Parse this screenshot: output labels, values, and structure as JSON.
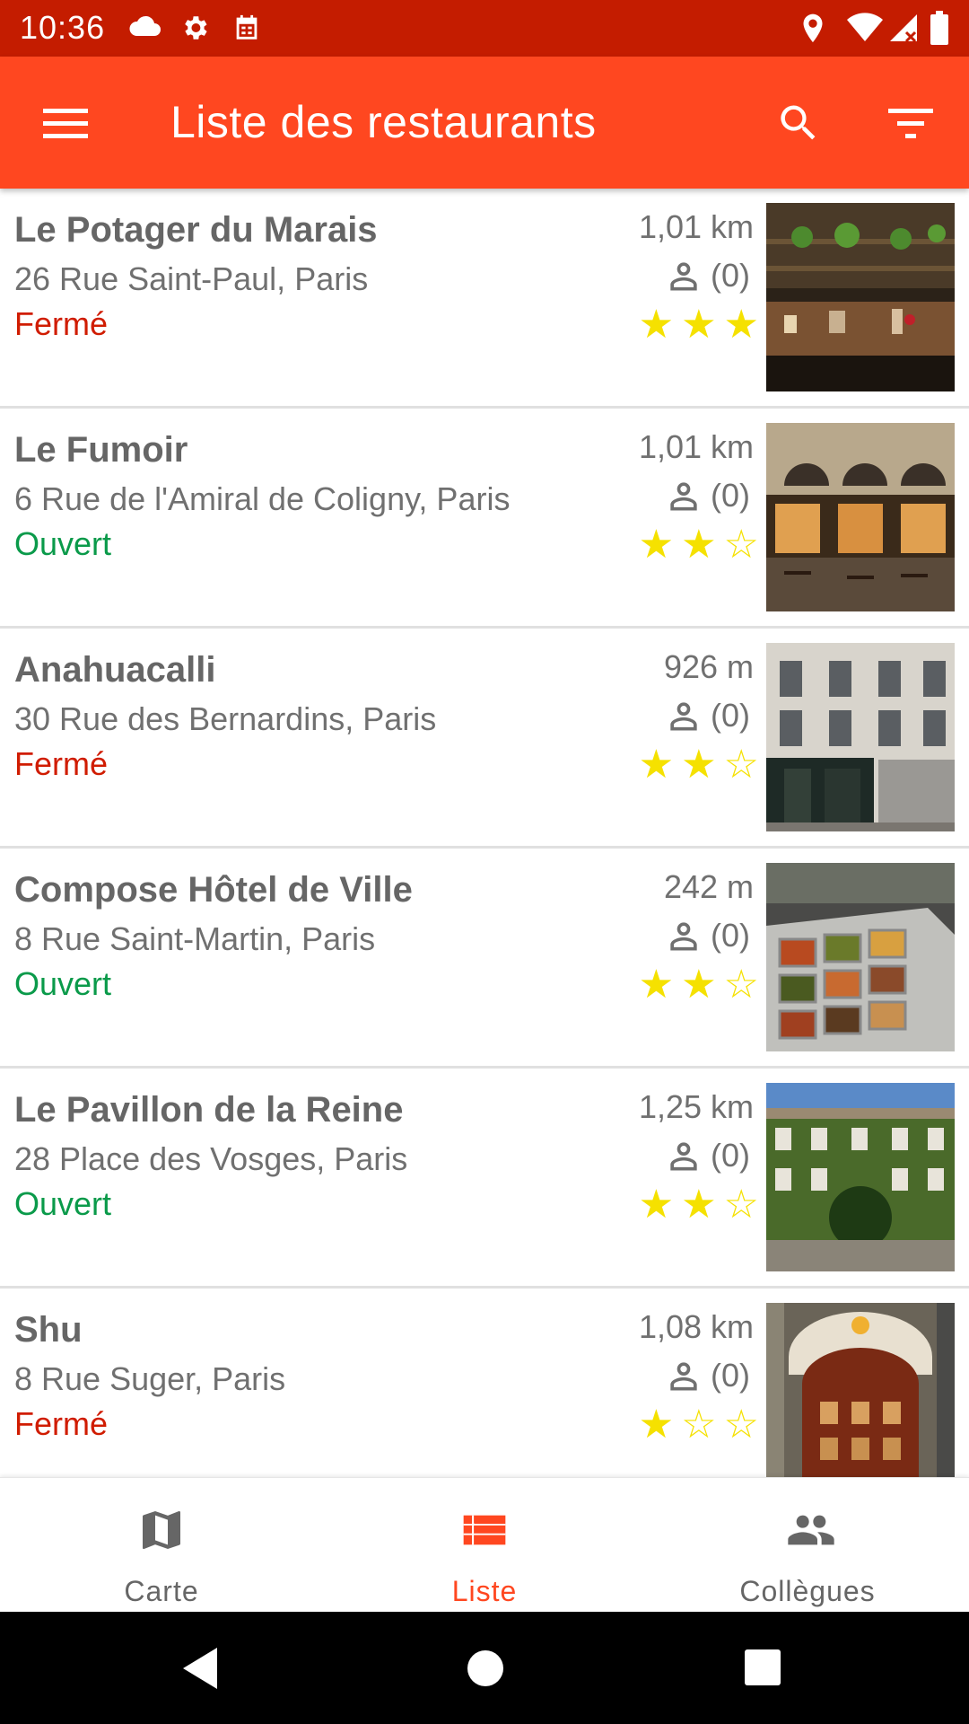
{
  "status_bar": {
    "time": "10:36"
  },
  "app_bar": {
    "title": "Liste des restaurants"
  },
  "colors": {
    "primary": "#ff4720",
    "status_bar": "#c41c00",
    "open": "#0a9a4a",
    "closed": "#d01c00",
    "star": "#f5e100"
  },
  "restaurants": [
    {
      "name": "Le Potager du Marais",
      "address": "26 Rue Saint-Paul, Paris",
      "status": "Fermé",
      "open": false,
      "distance": "1,01 km",
      "reviews": "(0)",
      "rating": 3
    },
    {
      "name": "Le Fumoir",
      "address": "6 Rue de l'Amiral de Coligny, Paris",
      "status": "Ouvert",
      "open": true,
      "distance": "1,01 km",
      "reviews": "(0)",
      "rating": 2
    },
    {
      "name": "Anahuacalli",
      "address": "30 Rue des Bernardins, Paris",
      "status": "Fermé",
      "open": false,
      "distance": "926 m",
      "reviews": "(0)",
      "rating": 2
    },
    {
      "name": "Compose Hôtel de Ville",
      "address": "8 Rue Saint-Martin, Paris",
      "status": "Ouvert",
      "open": true,
      "distance": "242 m",
      "reviews": "(0)",
      "rating": 2
    },
    {
      "name": "Le Pavillon de la Reine",
      "address": "28 Place des Vosges, Paris",
      "status": "Ouvert",
      "open": true,
      "distance": "1,25 km",
      "reviews": "(0)",
      "rating": 2
    },
    {
      "name": "Shu",
      "address": "8 Rue Suger, Paris",
      "status": "Fermé",
      "open": false,
      "distance": "1,08 km",
      "reviews": "(0)",
      "rating": 1
    }
  ],
  "bottom_nav": {
    "items": [
      {
        "label": "Carte",
        "icon": "map-icon",
        "active": false
      },
      {
        "label": "Liste",
        "icon": "list-icon",
        "active": true
      },
      {
        "label": "Collègues",
        "icon": "people-icon",
        "active": false
      }
    ]
  }
}
